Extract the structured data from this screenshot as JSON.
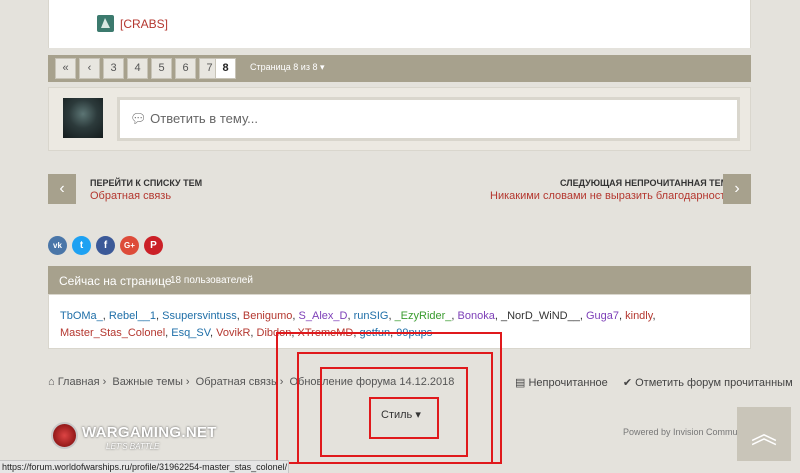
{
  "post": {
    "clan_tag": "[CRABS]"
  },
  "pagination": {
    "first": "«",
    "prev": "‹",
    "pages": [
      "3",
      "4",
      "5",
      "6",
      "7",
      "8"
    ],
    "current": "8",
    "page_of": "Страница 8 из 8 ▾"
  },
  "reply": {
    "placeholder": "Ответить в тему..."
  },
  "nav": {
    "prev_title": "ПЕРЕЙТИ К СПИСКУ ТЕМ",
    "prev_link": "Обратная связь",
    "next_title": "СЛЕДУЮЩАЯ НЕПРОЧИТАННАЯ ТЕМА",
    "next_link": "Никакими словами не выразить благодарность"
  },
  "share": [
    {
      "icon": "vk-icon",
      "glyph": "vk",
      "color": "#4a76a8"
    },
    {
      "icon": "twitter-icon",
      "glyph": "t",
      "color": "#1da1f2"
    },
    {
      "icon": "facebook-icon",
      "glyph": "f",
      "color": "#3b5998"
    },
    {
      "icon": "google-plus-icon",
      "glyph": "G+",
      "color": "#dd4b39"
    },
    {
      "icon": "pinterest-icon",
      "glyph": "P",
      "color": "#cb2027"
    }
  ],
  "online": {
    "title": "Сейчас на странице",
    "count": "18 пользователей",
    "users": [
      {
        "name": "TbOMa_",
        "color": "#1f6fa8"
      },
      {
        "name": "Rebel__1",
        "color": "#1f6fa8"
      },
      {
        "name": "Ssupersvintuss",
        "color": "#1f6fa8"
      },
      {
        "name": "Benigumo",
        "color": "#b4372f"
      },
      {
        "name": "S_Alex_D",
        "color": "#7d3fb8"
      },
      {
        "name": "runSIG",
        "color": "#1f6fa8"
      },
      {
        "name": "_EzyRider_",
        "color": "#3a9c2f"
      },
      {
        "name": "Bonoka",
        "color": "#7d3fb8"
      },
      {
        "name": "_NorD_WiND__",
        "color": "#333333"
      },
      {
        "name": "Guga7",
        "color": "#7d3fb8"
      },
      {
        "name": "kindly",
        "color": "#b4372f"
      },
      {
        "name": "Master_Stas_Colonel",
        "color": "#b4372f"
      },
      {
        "name": "Esq_SV",
        "color": "#1f6fa8"
      },
      {
        "name": "VovikR",
        "color": "#b4372f"
      },
      {
        "name": "Dibdon",
        "color": "#b4372f"
      },
      {
        "name": "XTremeMD",
        "color": "#b4372f"
      },
      {
        "name": "getfun",
        "color": "#1f6fa8"
      },
      {
        "name": "99pups",
        "color": "#1f6fa8"
      }
    ]
  },
  "breadcrumb": {
    "home": "⌂ Главная",
    "sep": "›",
    "item1": "Важные темы",
    "item2": "Обратная связь",
    "item3": "Обновление форума 14.12.2018"
  },
  "footer_links": {
    "unread": "▤ Непрочитанное",
    "mark_read": "✔ Отметить форум прочитанным"
  },
  "style_button": "Стиль ▾",
  "logo": {
    "name": "WARGAMING.NET",
    "tagline": "LET'S BATTLE"
  },
  "powered": "Powered by Invision Community",
  "status_url": "https://forum.worldofwarships.ru/profile/31962254-master_stas_colonel/",
  "accent_color": "#b4372f",
  "bar_color": "#a7a18d"
}
